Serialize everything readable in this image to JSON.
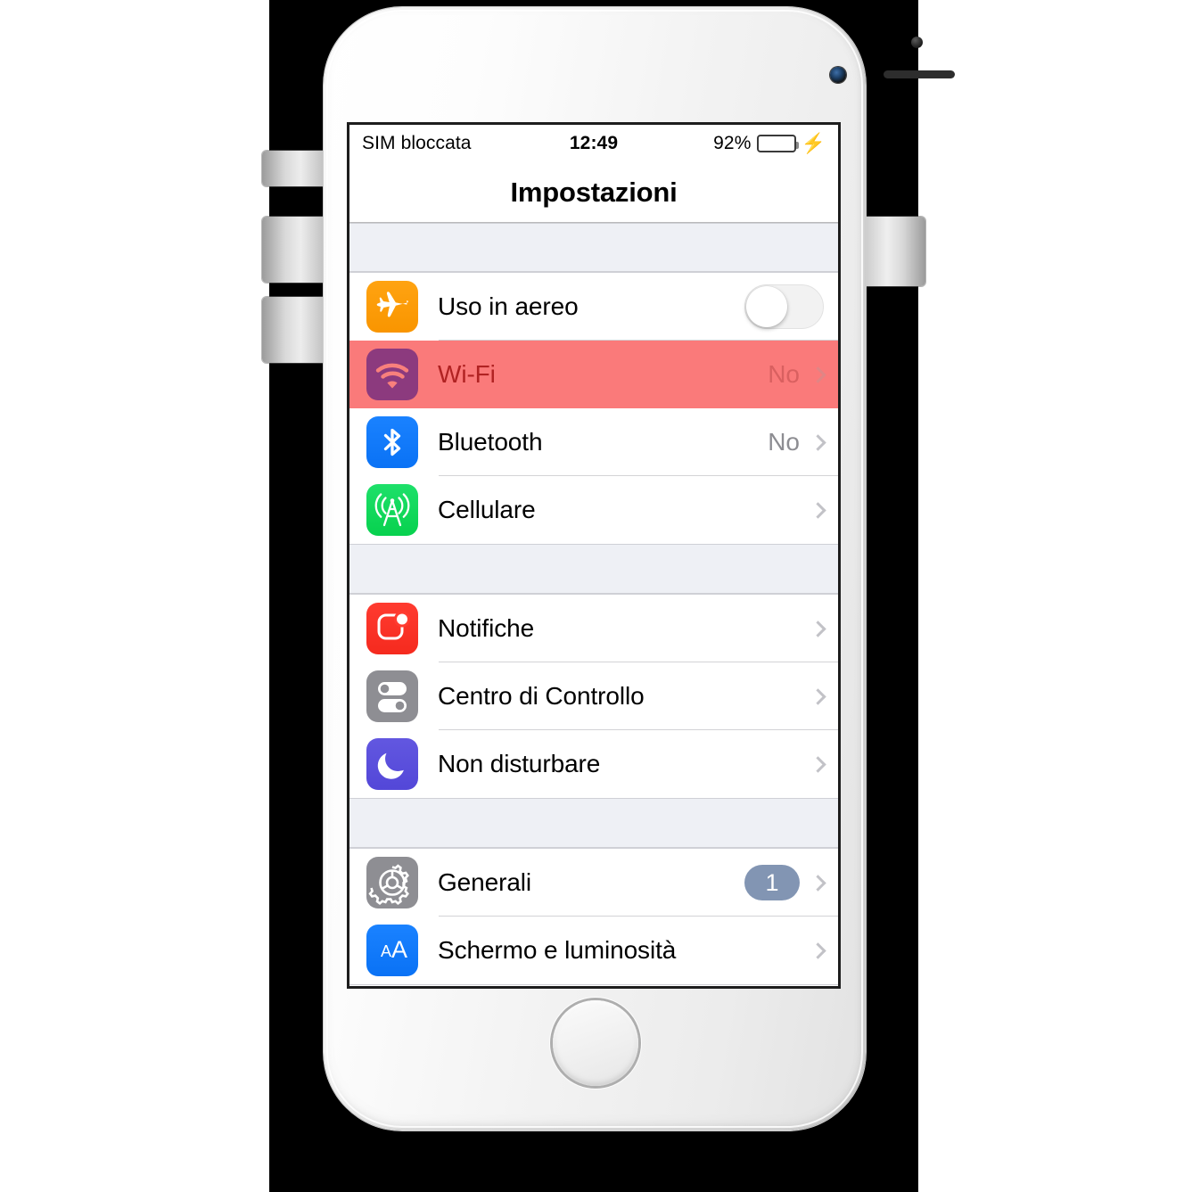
{
  "device": {
    "name": "iphone-white",
    "hardware": {
      "proximity_sensor": "proximity-sensor",
      "front_camera": "front-camera",
      "earpiece_speaker": "earpiece-speaker",
      "home_button": "home-button",
      "mute_switch": "mute-switch",
      "volume_up": "volume-up-button",
      "volume_down": "volume-down-button",
      "power": "power-button"
    }
  },
  "statusbar": {
    "carrier": "SIM bloccata",
    "time": "12:49",
    "battery_percent": "92%",
    "battery_level": 92,
    "charging": true,
    "charging_glyph": "⚡",
    "battery_color": "#2fdd63"
  },
  "navbar": {
    "title": "Impostazioni"
  },
  "colors": {
    "highlight_row_bg": "#fa7a7a",
    "highlight_row_text": "#b02222",
    "table_bg": "#eef0f5",
    "value_text": "#8d8d92",
    "badge_bg": "#8295b3",
    "chevron": "#c2c2c7"
  },
  "sections": [
    {
      "rows": [
        {
          "label": "Uso in aereo",
          "icon": "airplane-icon",
          "icon_class": "ic-airplane",
          "accessory": "toggle",
          "toggle_on": false,
          "value": ""
        },
        {
          "label": "Wi-Fi",
          "icon": "wifi-icon",
          "icon_class": "ic-wifi",
          "accessory": "chevron",
          "value": "No",
          "highlighted": true
        },
        {
          "label": "Bluetooth",
          "icon": "bluetooth-icon",
          "icon_class": "ic-bt",
          "accessory": "chevron",
          "value": "No"
        },
        {
          "label": "Cellulare",
          "icon": "cellular-icon",
          "icon_class": "ic-cell",
          "accessory": "chevron",
          "value": ""
        }
      ]
    },
    {
      "rows": [
        {
          "label": "Notifiche",
          "icon": "notifications-icon",
          "icon_class": "ic-notif",
          "accessory": "chevron",
          "value": ""
        },
        {
          "label": "Centro di Controllo",
          "icon": "control-center-icon",
          "icon_class": "ic-cc",
          "accessory": "chevron",
          "value": ""
        },
        {
          "label": "Non disturbare",
          "icon": "do-not-disturb-moon-icon",
          "icon_class": "ic-dnd",
          "accessory": "chevron",
          "value": ""
        }
      ]
    },
    {
      "rows": [
        {
          "label": "Generali",
          "icon": "gear-icon",
          "icon_class": "ic-gen",
          "accessory": "badge-chevron",
          "badge": "1",
          "value": ""
        },
        {
          "label": "Schermo e luminosità",
          "icon": "display-brightness-aa-icon",
          "icon_class": "ic-aa",
          "accessory": "chevron",
          "value": ""
        }
      ]
    }
  ]
}
